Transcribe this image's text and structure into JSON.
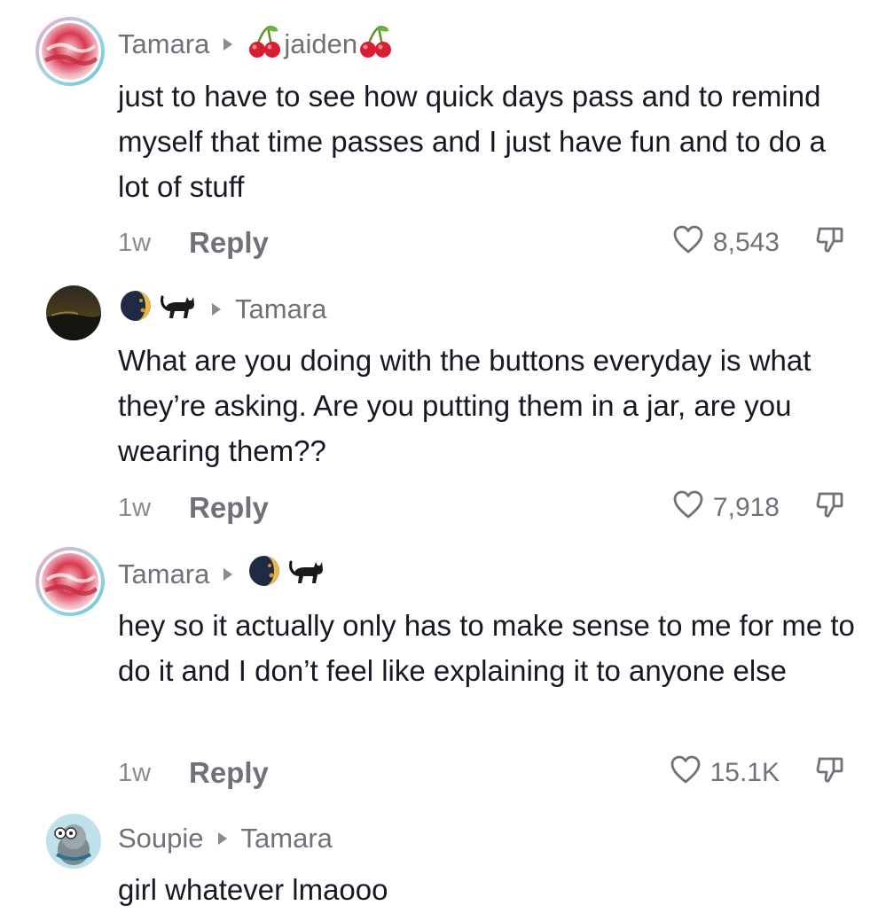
{
  "comments": [
    {
      "author": "Tamara",
      "reply_to": "jaiden",
      "text": "just to have to see how quick days pass and to remind myself that time passes and I just have fun and to do a lot of stuff",
      "time": "1w",
      "reply_label": "Reply",
      "likes": "8,543"
    },
    {
      "author": "",
      "reply_to": "Tamara",
      "text": "What are you doing with the buttons everyday is what they’re asking. Are you putting them in a jar, are you wearing them??",
      "time": "1w",
      "reply_label": "Reply",
      "likes": "7,918"
    },
    {
      "author": "Tamara",
      "reply_to": "",
      "text": "hey so it actually only has to make sense to me for me to do it and I don’t feel like explaining it to anyone else",
      "time": "1w",
      "reply_label": "Reply",
      "likes": "15.1K"
    },
    {
      "author": "Soupie",
      "reply_to": "Tamara",
      "text": "girl whatever lmaooo"
    }
  ],
  "icons": {
    "heart": "heart-outline-icon",
    "dislike": "thumbs-down-icon",
    "arrow": "reply-arrow-icon"
  }
}
